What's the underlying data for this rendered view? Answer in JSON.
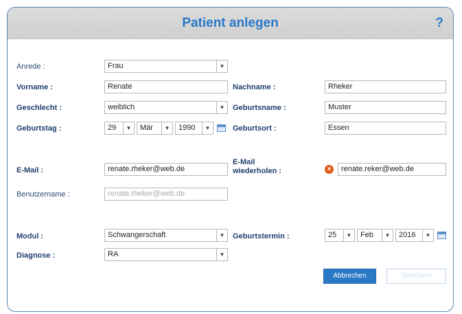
{
  "dialog": {
    "title": "Patient anlegen",
    "help_label": "?"
  },
  "form": {
    "anrede": {
      "label": "Anrede :",
      "value": "Frau"
    },
    "vorname": {
      "label": "Vorname :",
      "value": "Renate"
    },
    "nachname": {
      "label": "Nachname :",
      "value": "Rheker"
    },
    "geschlecht": {
      "label": "Geschlecht :",
      "value": "weiblich"
    },
    "geburtsname": {
      "label": "Geburtsname :",
      "value": "Muster"
    },
    "geburtstag": {
      "label": "Geburtstag :",
      "day": "29",
      "month": "Mär",
      "year": "1990"
    },
    "geburtsort": {
      "label": "Geburtsort :",
      "value": "Essen"
    },
    "email": {
      "label": "E-Mail :",
      "value": "renate.rheker@web.de"
    },
    "email_repeat": {
      "label_line1": "E-Mail",
      "label_line2": "wiederholen :",
      "value": "renate.reker@web.de",
      "error_icon": "error-icon"
    },
    "benutzername": {
      "label": "Benutzername :",
      "value": "renate.rheker@web.de"
    },
    "modul": {
      "label": "Modul :",
      "value": "Schwangerschaft"
    },
    "geburtstermin": {
      "label": "Geburtstermin :",
      "day": "25",
      "month": "Feb",
      "year": "2016"
    },
    "diagnose": {
      "label": "Diagnose :",
      "value": "RA"
    }
  },
  "buttons": {
    "cancel": "Abbrechen",
    "save": "Speichern"
  },
  "colors": {
    "accent": "#2b78c5",
    "title": "#2a78c8",
    "label": "#1f3f70",
    "error": "#e05a1c"
  }
}
